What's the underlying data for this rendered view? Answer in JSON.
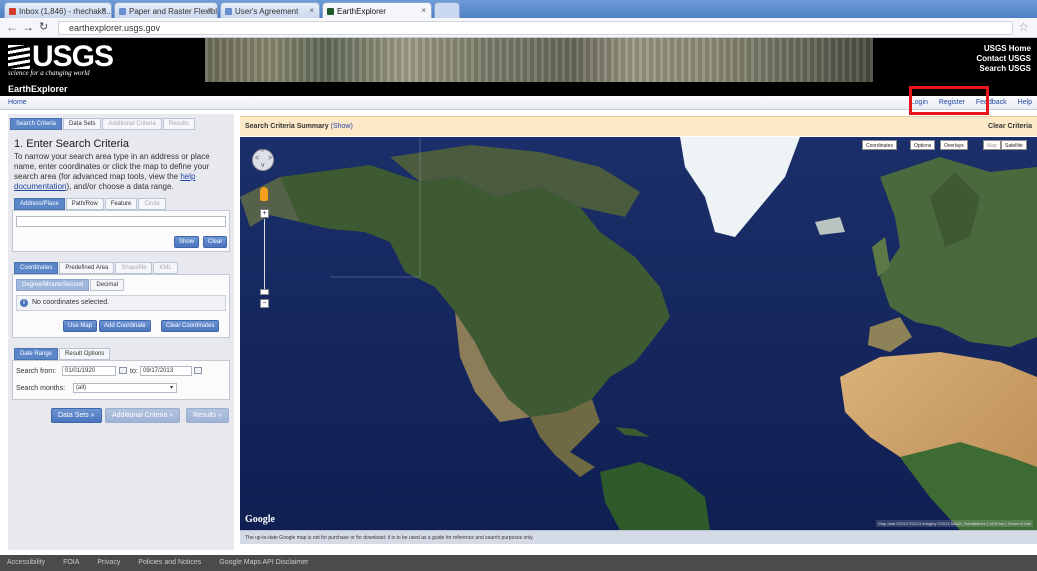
{
  "browser": {
    "tabs": [
      {
        "title": "Inbox (1,846) - rhechak8...",
        "favicon_color": "#d03b2a"
      },
      {
        "title": "Paper and Raster Flexible...",
        "favicon_color": "#6a8fd0"
      },
      {
        "title": "User's Agreement",
        "favicon_color": "#6a8fd0"
      },
      {
        "title": "EarthExplorer",
        "favicon_color": "#1d5a2b"
      }
    ],
    "url": "earthexplorer.usgs.gov"
  },
  "banner": {
    "logo": "USGS",
    "tagline": "science for a changing world",
    "links": [
      "USGS Home",
      "Contact USGS",
      "Search USGS"
    ]
  },
  "app_title": "EarthExplorer",
  "menubar": {
    "home": "Home",
    "links": [
      "Login",
      "Register",
      "Feedback",
      "Help"
    ]
  },
  "panel": {
    "main_tabs": [
      "Search Criteria",
      "Data Sets",
      "Additional Criteria",
      "Results"
    ],
    "step_title": "1. Enter Search Criteria",
    "step_text_a": "To narrow your search area type in an address or place name, enter coordinates or click the map to define your search area (for advanced map tools, view the ",
    "step_link": "help documentation",
    "step_text_b": "), and/or choose a data range.",
    "address_tabs": [
      "Address/Place",
      "Path/Row",
      "Feature",
      "Circle"
    ],
    "address_value": "",
    "show_btn": "Show",
    "clear_btn": "Clear",
    "coord_tabs": [
      "Coordinates",
      "Predefined Area",
      "Shapefile",
      "KML"
    ],
    "coord_format_tabs": [
      "Degree/Minute/Second",
      "Decimal"
    ],
    "no_coords": "No coordinates selected.",
    "use_map_btn": "Use Map",
    "add_coord_btn": "Add Coordinate",
    "clear_coords_btn": "Clear Coordinates",
    "date_tabs": [
      "Date Range",
      "Result Options"
    ],
    "search_from_label": "Search from:",
    "from_value": "01/01/1920",
    "to_label": "to:",
    "to_value": "09/17/2013",
    "months_label": "Search months:",
    "months_value": "(all)",
    "nav_buttons": [
      "Data Sets »",
      "Additional Criteria »",
      "Results »"
    ]
  },
  "summary": {
    "title": "Search Criteria Summary",
    "show": "(Show)",
    "clear": "Clear Criteria"
  },
  "map": {
    "buttons": [
      "Coordinates",
      "Options",
      "Overlays",
      "Map",
      "Satellite"
    ],
    "google": "Google",
    "attribution": "Map data ©2013 ©2013 Imagery ©2013 NASA, TerraMetrics | 1000 km | Terms of Use",
    "disclaimer": "The up-to-date Google map is not for purchase or for download; it is to be used as a guide for reference and search purposes only."
  },
  "footer": {
    "links": [
      "Accessibility",
      "FOIA",
      "Privacy",
      "Policies and Notices",
      "Google Maps API Disclaimer"
    ]
  },
  "colors": {
    "highlight": "#e8151a",
    "accent": "#5b86c8",
    "ocean": "#11245a"
  }
}
